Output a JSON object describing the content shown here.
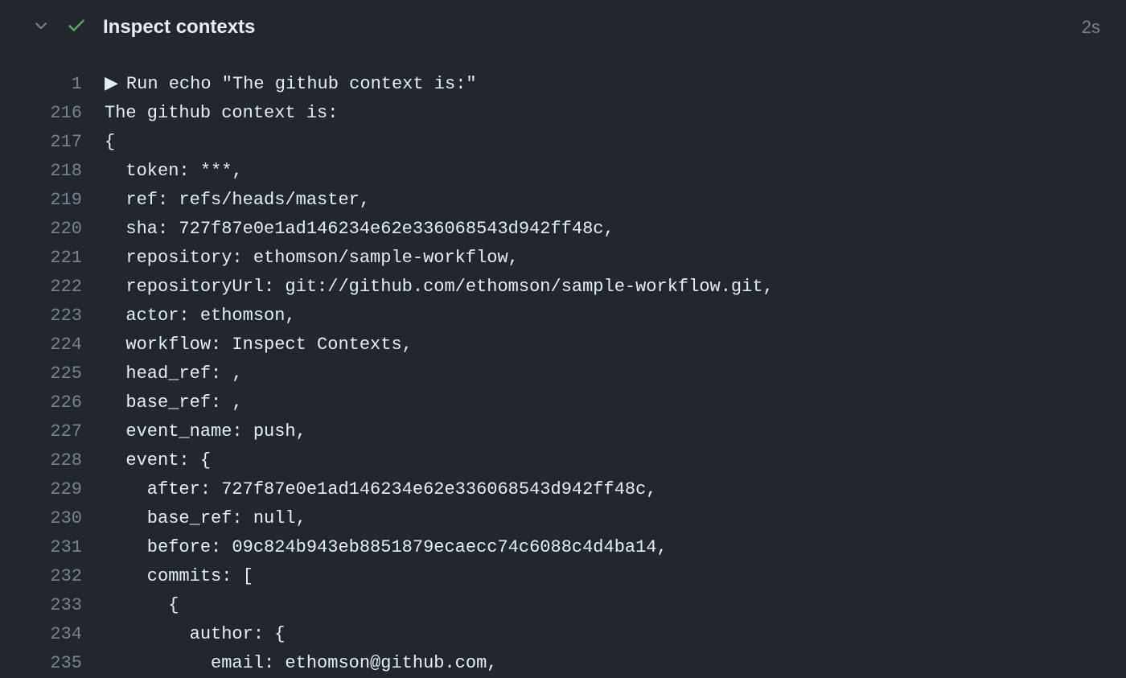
{
  "header": {
    "title": "Inspect contexts",
    "duration": "2s"
  },
  "log": {
    "lines": [
      {
        "num": "1",
        "text": "Run echo \"The github context is:\"",
        "marker": "▶"
      },
      {
        "num": "216",
        "text": "The github context is:"
      },
      {
        "num": "217",
        "text": "{"
      },
      {
        "num": "218",
        "text": "  token: ***,"
      },
      {
        "num": "219",
        "text": "  ref: refs/heads/master,"
      },
      {
        "num": "220",
        "text": "  sha: 727f87e0e1ad146234e62e336068543d942ff48c,"
      },
      {
        "num": "221",
        "text": "  repository: ethomson/sample-workflow,"
      },
      {
        "num": "222",
        "text": "  repositoryUrl: git://github.com/ethomson/sample-workflow.git,"
      },
      {
        "num": "223",
        "text": "  actor: ethomson,"
      },
      {
        "num": "224",
        "text": "  workflow: Inspect Contexts,"
      },
      {
        "num": "225",
        "text": "  head_ref: ,"
      },
      {
        "num": "226",
        "text": "  base_ref: ,"
      },
      {
        "num": "227",
        "text": "  event_name: push,"
      },
      {
        "num": "228",
        "text": "  event: {"
      },
      {
        "num": "229",
        "text": "    after: 727f87e0e1ad146234e62e336068543d942ff48c,"
      },
      {
        "num": "230",
        "text": "    base_ref: null,"
      },
      {
        "num": "231",
        "text": "    before: 09c824b943eb8851879ecaecc74c6088c4d4ba14,"
      },
      {
        "num": "232",
        "text": "    commits: ["
      },
      {
        "num": "233",
        "text": "      {"
      },
      {
        "num": "234",
        "text": "        author: {"
      },
      {
        "num": "235",
        "text": "          email: ethomson@github.com,"
      }
    ]
  }
}
